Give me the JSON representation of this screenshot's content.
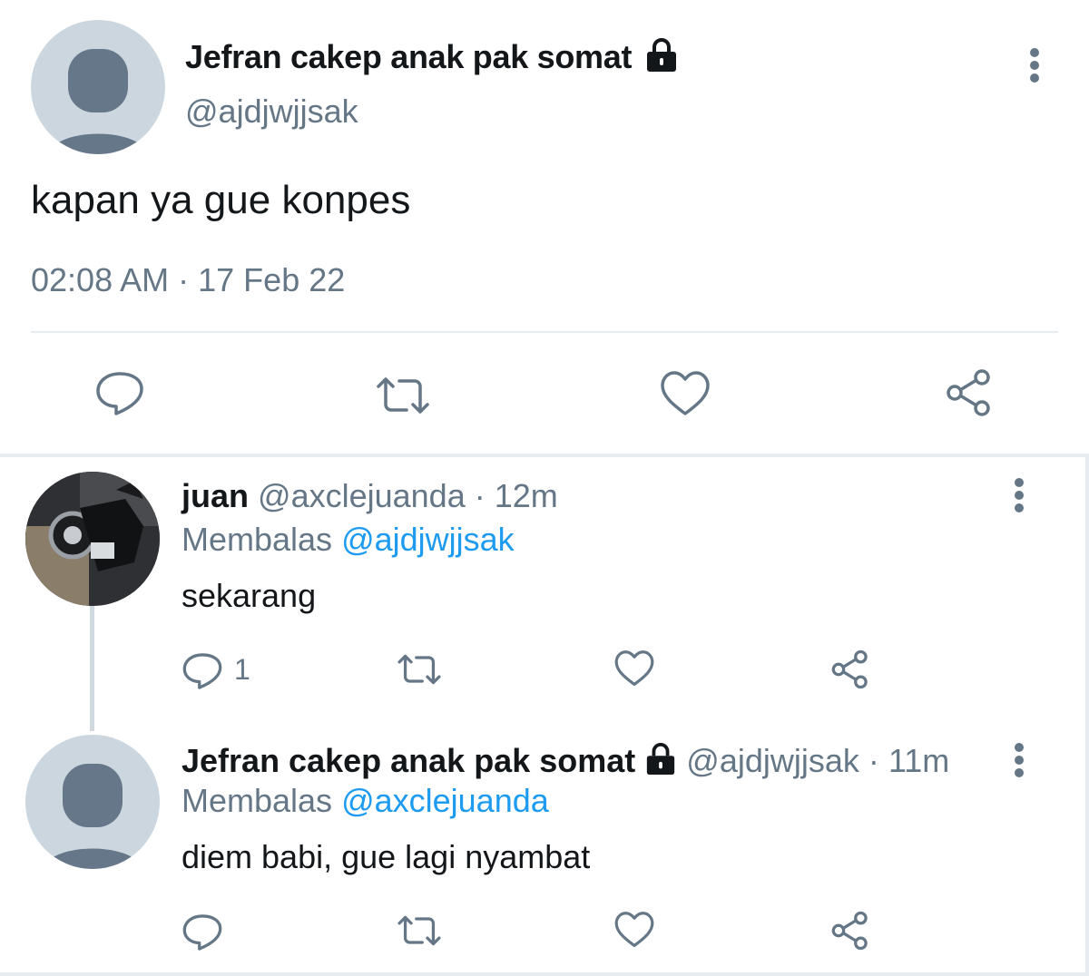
{
  "main_tweet": {
    "author_name": "Jefran cakep anak pak somat",
    "author_handle": "@ajdjwjjsak",
    "text": "kapan ya gue konpes",
    "time": "02:08 AM",
    "separator": "·",
    "date": "17 Feb 22",
    "verified_lock": "lock-icon"
  },
  "replies": [
    {
      "author_name": "juan",
      "author_handle": "@axclejuanda",
      "separator": "·",
      "time_ago": "12m",
      "reply_prefix": "Membalas",
      "reply_to": "@ajdjwjjsak",
      "text": "sekarang",
      "reply_count": "1"
    },
    {
      "author_name": "Jefran cakep anak pak somat",
      "author_handle": "@ajdjwjjsak",
      "separator": "·",
      "time_ago": "11m",
      "reply_prefix": "Membalas",
      "reply_to": "@axclejuanda",
      "text": "diem babi, gue lagi nyambat"
    }
  ],
  "colors": {
    "text": "#14171a",
    "secondary": "#657786",
    "link": "#1d9bf0",
    "divider": "#e6ecf0",
    "avatar_bg": "#cbd6df",
    "avatar_fg": "#66778a"
  },
  "icons": [
    "more-vertical-icon",
    "reply-icon",
    "retweet-icon",
    "like-icon",
    "share-icon",
    "lock-icon"
  ]
}
